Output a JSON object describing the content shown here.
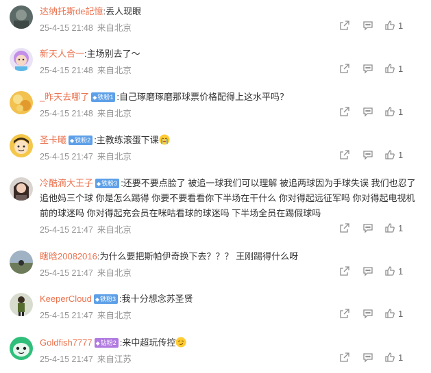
{
  "comments": [
    {
      "user": "达纳托斯de記憶",
      "badge": "",
      "text": ":丢人现眼",
      "time": "25-4-15 21:48",
      "source": "来自北京",
      "likes": "1"
    },
    {
      "user": "新天人合一",
      "badge": "",
      "text": ":主场别去了～",
      "time": "25-4-15 21:48",
      "source": "来自北京",
      "likes": "1"
    },
    {
      "user": "_昨天去哪了",
      "badge": "铁粉1",
      "text": ":自己琢磨琢磨那球票价格配得上这水平吗？",
      "time": "25-4-15 21:48",
      "source": "来自北京",
      "likes": "1"
    },
    {
      "user": "圣卡曦",
      "badge": "铁粉2",
      "text": ":主教练滚蛋下课",
      "time": "25-4-15 21:47",
      "source": "来自北京",
      "likes": "1"
    },
    {
      "user": "冷酷滴大王子",
      "badge": "铁粉3",
      "text": ":还要不要点脸了 被追一球我们可以理解 被追两球因为手球失误 我们也忍了 追他妈三个球 你是怎么踢得 你要不要看看你下半场在干什么 你对得起远征军吗 你对得起电视机前的球迷吗 你对得起充会员在咪咕看球的球迷吗 下半场全员在踢假球吗",
      "time": "25-4-15 21:47",
      "source": "来自北京",
      "likes": "1"
    },
    {
      "user": "瞎晗20082016",
      "badge": "",
      "text": ":为什么要把斯帕伊奇换下去？？？ 王刚踢得什么呀",
      "time": "25-4-15 21:47",
      "source": "来自北京",
      "likes": "1"
    },
    {
      "user": "KeeperCloud",
      "badge": "铁粉3",
      "text": ":我十分想念苏圣贤",
      "time": "25-4-15 21:47",
      "source": "来自北京",
      "likes": "1"
    },
    {
      "user": "Goldfish7777",
      "badge": "钻粉2",
      "text": ":来中超玩传控",
      "time": "25-4-15 21:47",
      "source": "来自江苏",
      "likes": "1"
    }
  ],
  "icons": {
    "share": "share-icon",
    "comment": "comment-icon",
    "like": "thumbs-up-icon",
    "badge": "diamond-icon"
  },
  "colors": {
    "username": "#eb7350",
    "meta": "#939393",
    "badge_blue": "#5ea0e8",
    "badge_purple": "#b07ae0"
  }
}
